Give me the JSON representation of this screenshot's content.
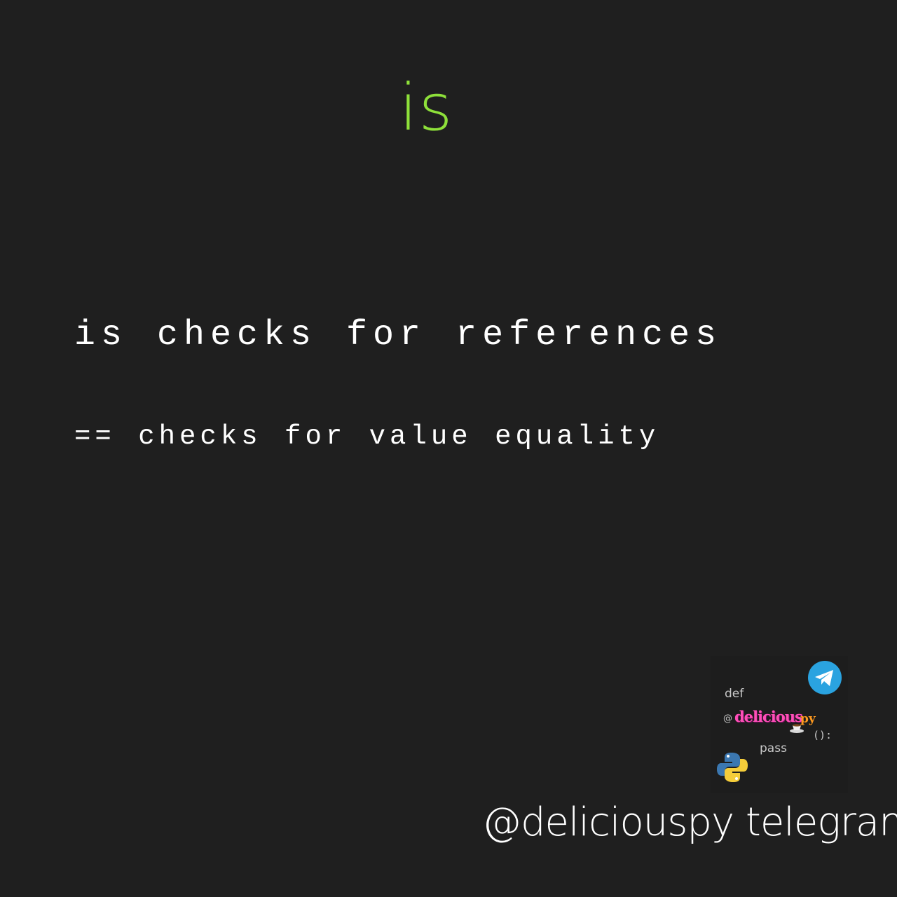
{
  "title": "is",
  "lines": [
    "is checks for references",
    "== checks for value equality"
  ],
  "logo": {
    "def": "def",
    "at": "@",
    "name": "delicious",
    "suffix": "py",
    "paren": "():",
    "pass": "pass",
    "icons": [
      "telegram-icon",
      "python-icon",
      "coffee-cup-icon"
    ]
  },
  "footer": "@deliciouspy telegram",
  "colors": {
    "background": "#1f1f1f",
    "title": "#8ee03a",
    "text": "#ffffff",
    "logo_name": "#ff4fb8",
    "telegram": "#2aa3e0"
  }
}
